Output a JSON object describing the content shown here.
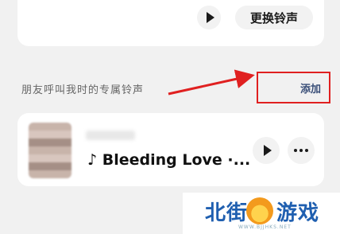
{
  "top_card": {
    "change_label": "更换铃声"
  },
  "friends_section": {
    "label": "朋友呼叫我时的专属铃声",
    "add_label": "添加"
  },
  "song": {
    "title": "♪ Bleeding Love ·..."
  },
  "watermark": {
    "left": "北街",
    "right": "游戏",
    "url": "WWW.BJJHKS.NET"
  },
  "colors": {
    "highlight_border": "#e02020",
    "add_text": "#3a4f78",
    "watermark_blue": "#1f5fb0"
  }
}
